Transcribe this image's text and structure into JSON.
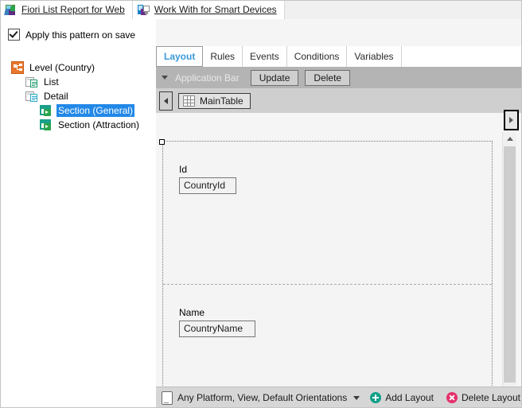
{
  "document_tabs": [
    {
      "label": "Fiori List Report for Web",
      "icon": "web-object-icon",
      "active": true
    },
    {
      "label": "Work With for Smart Devices",
      "icon": "smart-device-object-icon",
      "active": false
    }
  ],
  "left_panel": {
    "apply_checkbox": {
      "label": "Apply this pattern on save",
      "checked": true
    },
    "tree": [
      {
        "label": "Level (Country)",
        "icon": "level-icon",
        "indent": 0,
        "selected": false
      },
      {
        "label": "List",
        "icon": "list-icon",
        "indent": 1,
        "selected": false
      },
      {
        "label": "Detail",
        "icon": "detail-icon",
        "indent": 1,
        "selected": false
      },
      {
        "label": "Section (General)",
        "icon": "section-icon",
        "indent": 2,
        "selected": true
      },
      {
        "label": "Section (Attraction)",
        "icon": "section-icon",
        "indent": 2,
        "selected": false
      }
    ]
  },
  "right_panel": {
    "tabs": [
      {
        "label": "Layout",
        "active": true
      },
      {
        "label": "Rules",
        "active": false
      },
      {
        "label": "Events",
        "active": false
      },
      {
        "label": "Conditions",
        "active": false
      },
      {
        "label": "Variables",
        "active": false
      }
    ],
    "application_bar": {
      "title": "Application Bar",
      "buttons": [
        {
          "label": "Update"
        },
        {
          "label": "Delete"
        }
      ]
    },
    "table_bar": {
      "scroll_left_label": "◀",
      "scroll_right_label": "▶",
      "chip": {
        "label": "MainTable",
        "icon": "table-icon"
      }
    },
    "canvas": {
      "sections": [
        {
          "name": "general",
          "fields": [
            {
              "label": "Id",
              "value": "CountryId"
            }
          ]
        },
        {
          "name": "attraction",
          "fields": [
            {
              "label": "Name",
              "value": "CountryName"
            }
          ]
        }
      ]
    },
    "status_bar": {
      "platform_text": "Any Platform, View, Default Orientations",
      "add_layout_label": "Add Layout",
      "delete_layout_label": "Delete Layout"
    }
  },
  "colors": {
    "selection_blue": "#2288e8",
    "active_tab_blue": "#3a9ad9",
    "level_orange": "#e8762c",
    "section_teal": "#19a08a",
    "add_green": "#12a08a",
    "delete_pink": "#e4316c",
    "toolbar_gray": "#b4b4b4"
  }
}
